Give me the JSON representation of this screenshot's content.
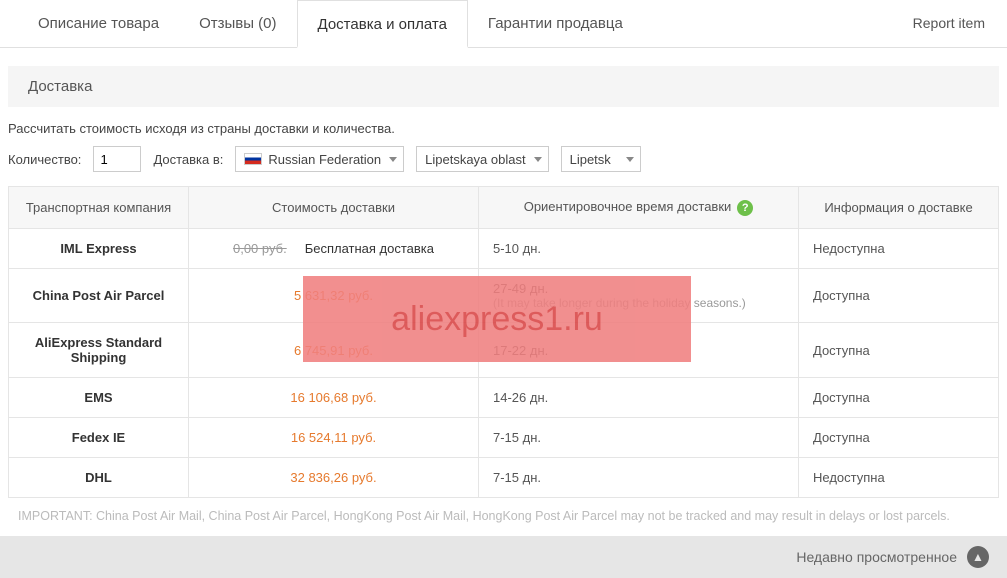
{
  "tabs": [
    "Описание товара",
    "Отзывы (0)",
    "Доставка и оплата",
    "Гарантии продавца"
  ],
  "active_tab": 2,
  "report": "Report item",
  "section": "Доставка",
  "calc": "Рассчитать стоимость исходя из страны доставки и количества.",
  "qty_label": "Количество:",
  "qty_value": "1",
  "shipto_label": "Доставка в:",
  "country": "Russian Federation",
  "region": "Lipetskaya oblast",
  "city": "Lipetsk",
  "headers": {
    "company": "Транспортная компания",
    "cost": "Стоимость доставки",
    "time": "Ориентировочное время доставки",
    "info": "Информация о доставке"
  },
  "help": "?",
  "rows": [
    {
      "company": "IML Express",
      "old": "0,00 руб.",
      "free": "Бесплатная доставка",
      "time": "5-10 дн.",
      "note": "",
      "info": "Недоступна"
    },
    {
      "company": "China Post Air Parcel",
      "cost": "5 631,32 руб.",
      "time": "27-49 дн.",
      "note": "(It may take longer during the holiday seasons.)",
      "info": "Доступна"
    },
    {
      "company": "AliExpress Standard Shipping",
      "cost": "6 745,91 руб.",
      "time": "17-22 дн.",
      "note": "",
      "info": "Доступна"
    },
    {
      "company": "EMS",
      "cost": "16 106,68 руб.",
      "time": "14-26 дн.",
      "note": "",
      "info": "Доступна"
    },
    {
      "company": "Fedex IE",
      "cost": "16 524,11 руб.",
      "time": "7-15 дн.",
      "note": "",
      "info": "Доступна"
    },
    {
      "company": "DHL",
      "cost": "32 836,26 руб.",
      "time": "7-15 дн.",
      "note": "",
      "info": "Недоступна"
    }
  ],
  "important": "IMPORTANT: China Post Air Mail, China Post Air Parcel, HongKong Post Air Mail, HongKong Post Air Parcel may not be tracked and may result in delays or lost parcels.",
  "recent": "Недавно просмотренное",
  "watermark": "aliexpress1.ru"
}
